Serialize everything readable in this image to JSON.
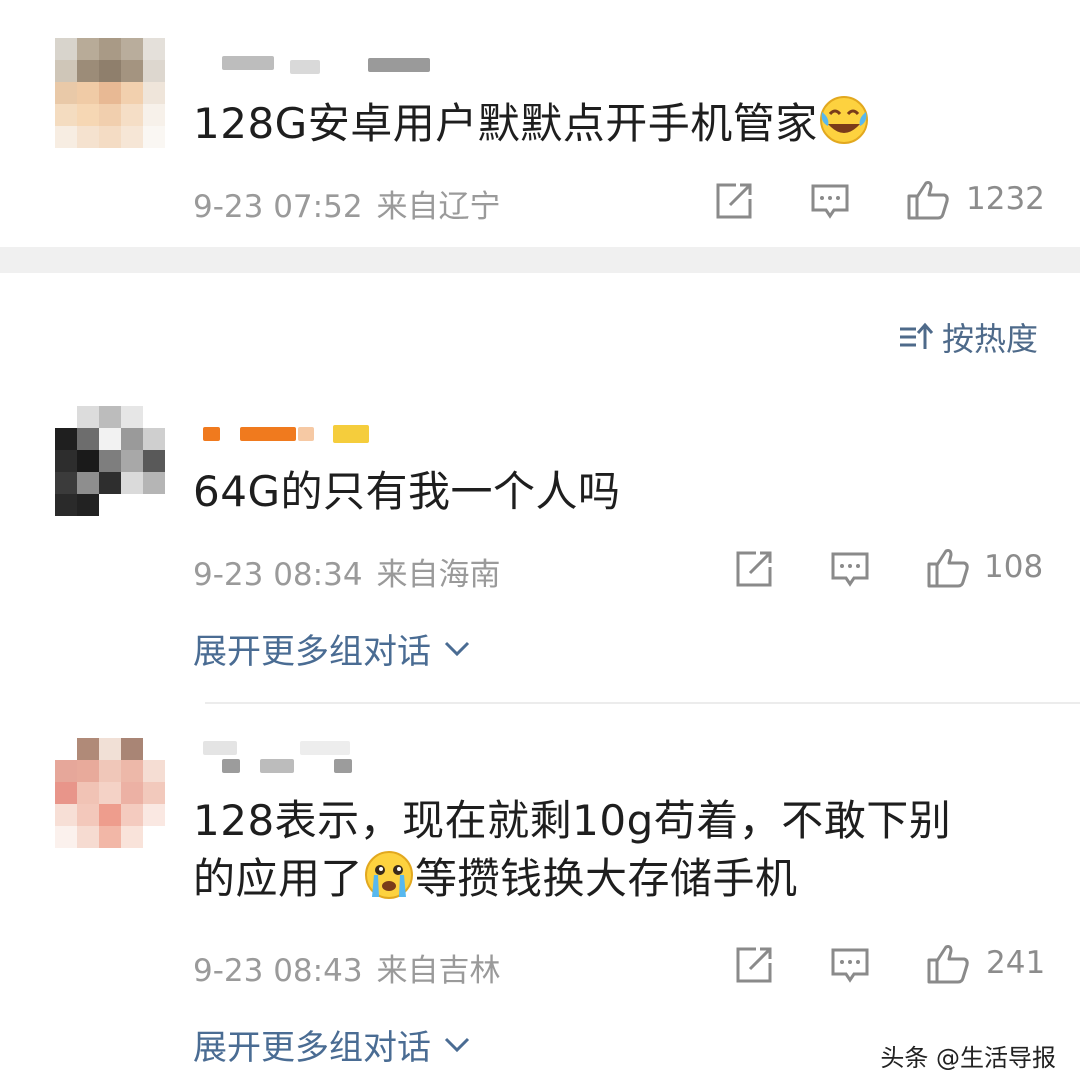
{
  "colors": {
    "link": "#4a6c93",
    "meta": "#9a9a9a",
    "divider": "#f0f0f0",
    "badge_orange": "#f07a1e",
    "badge_yellow": "#f5cd3c"
  },
  "sort_label": "按热度",
  "comments": [
    {
      "text": "128G安卓用户默默点开手机管家",
      "emoji": "laughing-crying-emoji",
      "time": "9-23 07:52",
      "location": "来自辽宁",
      "likes": "1232"
    },
    {
      "text": "64G的只有我一个人吗",
      "time": "9-23 08:34",
      "location": "来自海南",
      "likes": "108",
      "expand_label": "展开更多组对话"
    },
    {
      "text_line1": "128表示，现在就剩10g苟着，不敢下别",
      "text_line2_before": "的应用了",
      "emoji": "crying-emoji",
      "text_line2_after": "等攒钱换大存储手机",
      "time": "9-23 08:43",
      "location": "来自吉林",
      "likes": "241",
      "expand_label": "展开更多组对话"
    }
  ],
  "watermark": "头条 @生活导报"
}
